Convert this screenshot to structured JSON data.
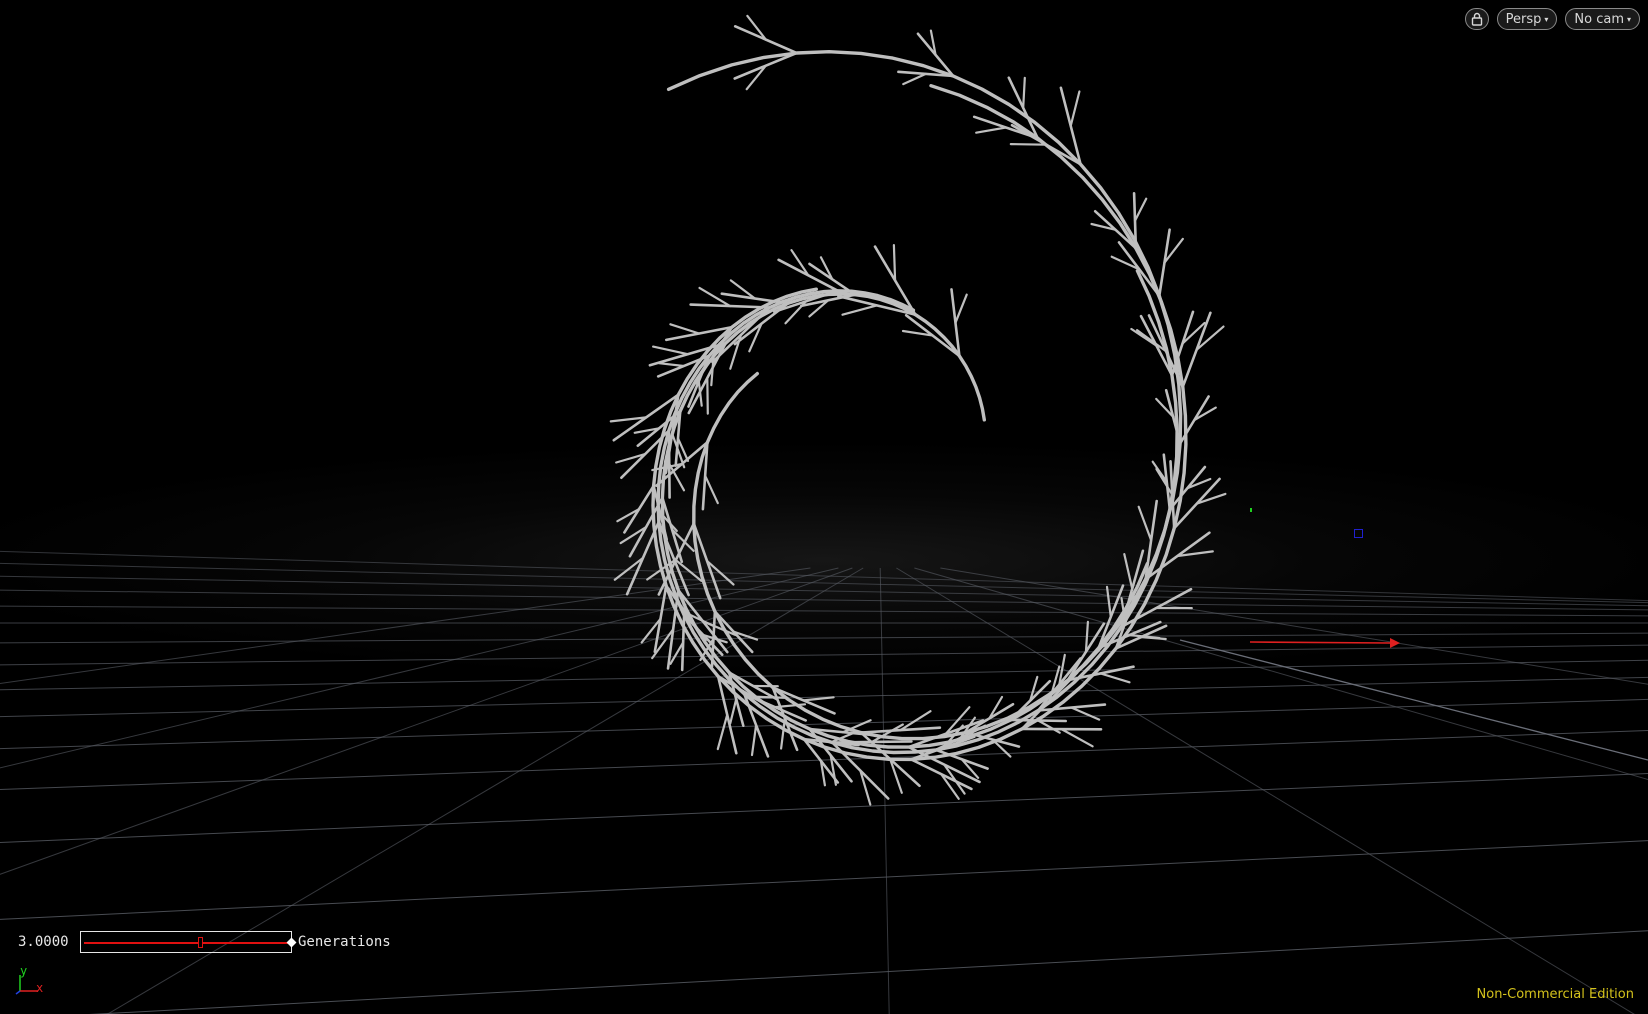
{
  "header": {
    "lock_icon": "lock-icon",
    "view_menu": {
      "label": "Persp",
      "caret": "▾"
    },
    "camera_menu": {
      "label": "No cam",
      "caret": "▾"
    }
  },
  "parameter": {
    "value": "3.0000",
    "label": "Generations",
    "slider_fraction": 0.58
  },
  "axes": {
    "y": "y",
    "x": "x"
  },
  "footer": {
    "edition": "Non-Commercial Edition"
  },
  "colors": {
    "background": "#000000",
    "grid": "#5a5e66",
    "geometry": "#bfbfbf",
    "x_axis": "#e02020",
    "y_axis": "#20d020",
    "handle": "#2020d0",
    "watermark": "#d4c21c"
  }
}
